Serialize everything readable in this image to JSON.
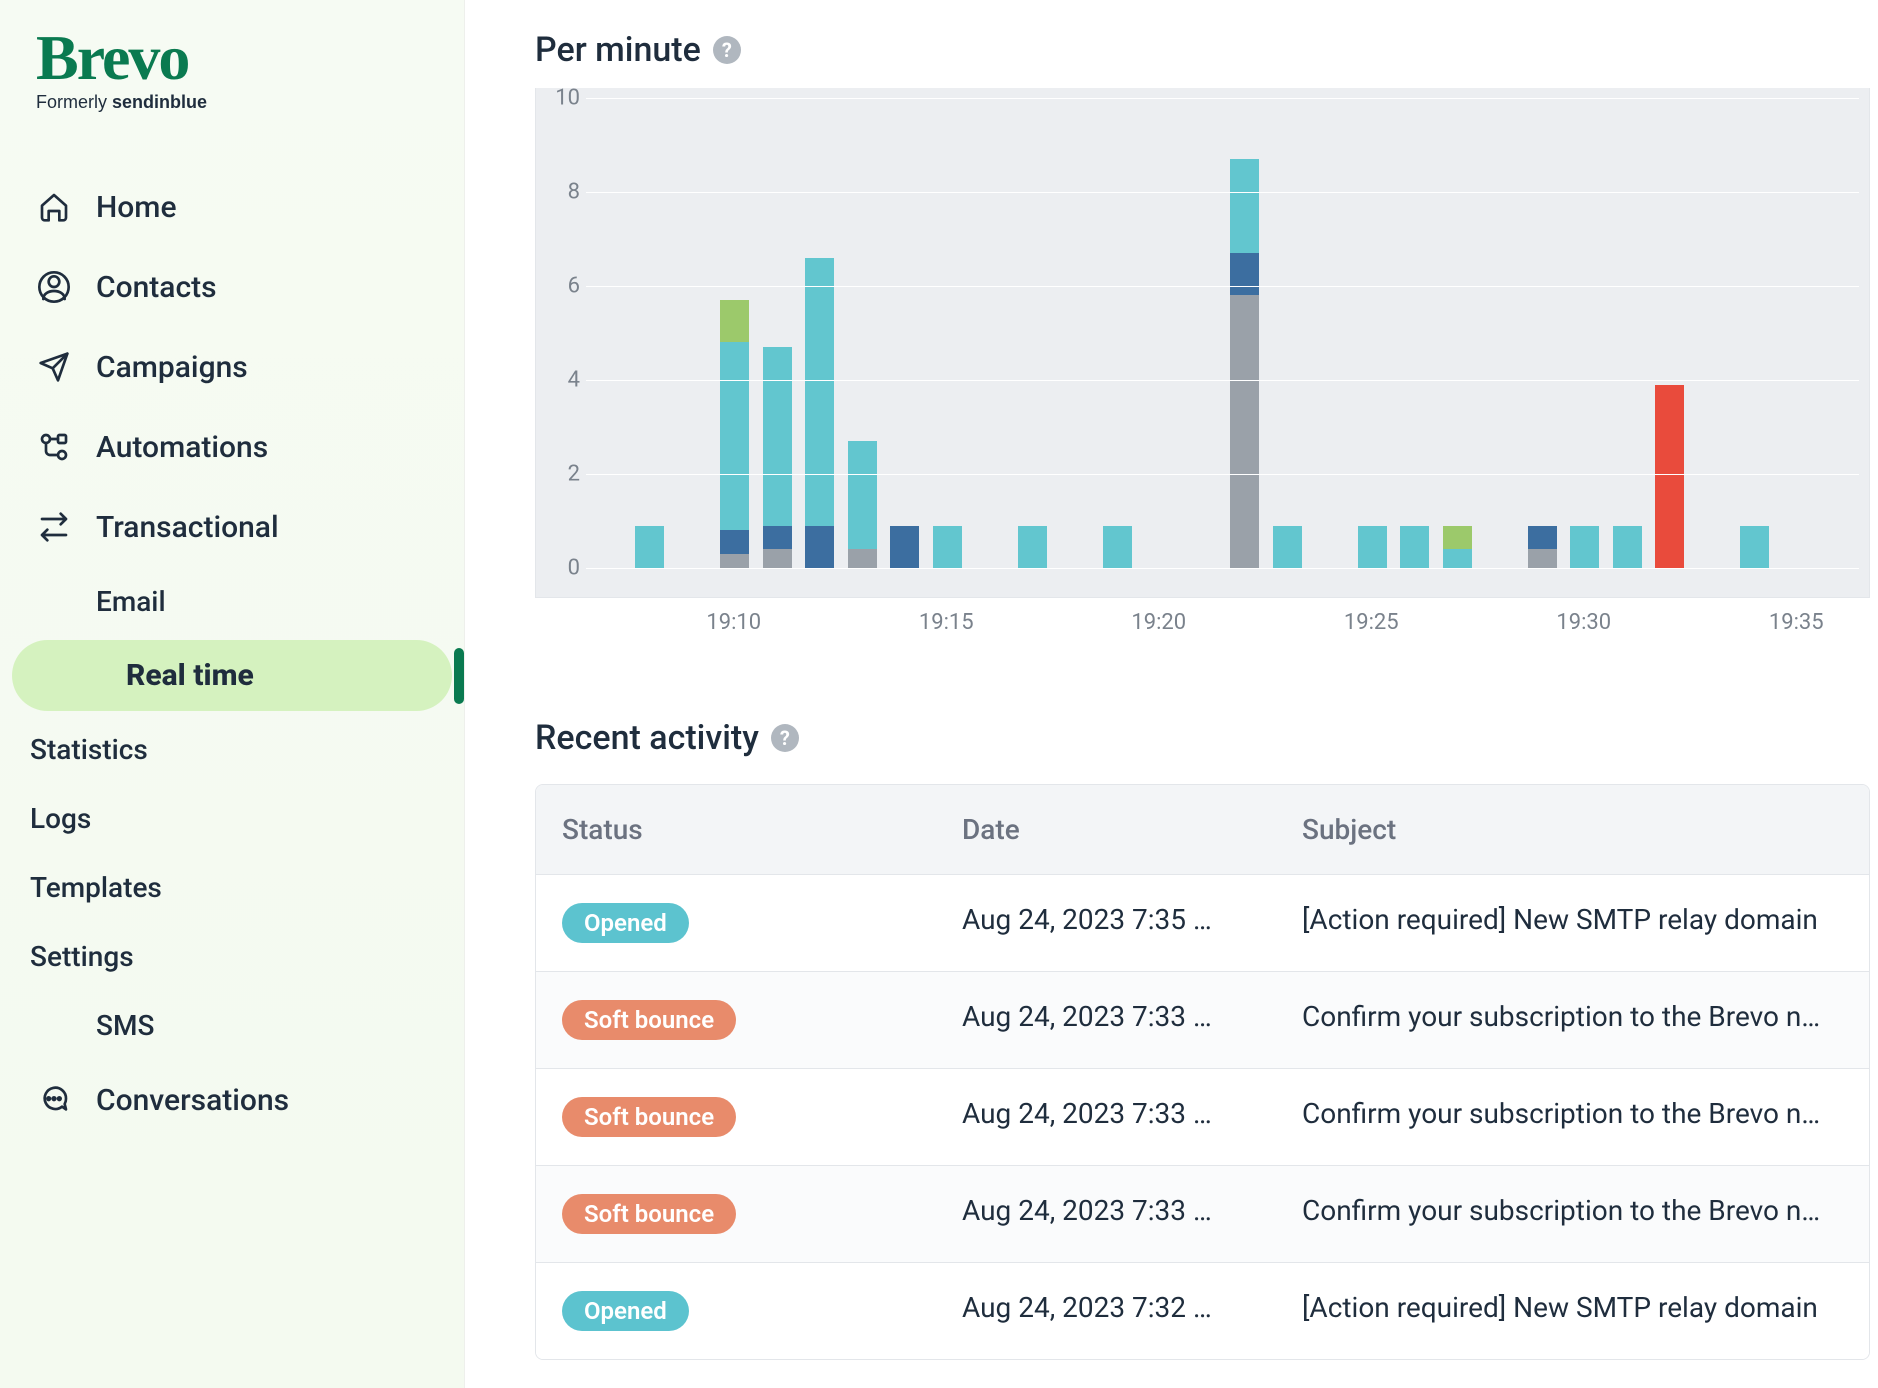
{
  "brand": {
    "name": "Brevo",
    "tagline_prefix": "Formerly ",
    "tagline_bold": "sendinblue"
  },
  "nav": {
    "home": "Home",
    "contacts": "Contacts",
    "campaigns": "Campaigns",
    "automations": "Automations",
    "transactional": "Transactional",
    "email": "Email",
    "real_time": "Real time",
    "statistics": "Statistics",
    "logs": "Logs",
    "templates": "Templates",
    "settings": "Settings",
    "sms": "SMS",
    "conversations": "Conversations"
  },
  "sections": {
    "per_minute": "Per minute",
    "recent_activity": "Recent activity"
  },
  "table": {
    "headers": {
      "status": "Status",
      "date": "Date",
      "subject": "Subject"
    },
    "rows": [
      {
        "status": "Opened",
        "status_class": "opened",
        "date": "Aug 24, 2023 7:35 …",
        "subject": "[Action required] New SMTP relay domain"
      },
      {
        "status": "Soft bounce",
        "status_class": "soft-bounce",
        "date": "Aug 24, 2023 7:33 …",
        "subject": "Confirm your subscription to the Brevo n…"
      },
      {
        "status": "Soft bounce",
        "status_class": "soft-bounce",
        "date": "Aug 24, 2023 7:33 …",
        "subject": "Confirm your subscription to the Brevo n…"
      },
      {
        "status": "Soft bounce",
        "status_class": "soft-bounce",
        "date": "Aug 24, 2023 7:33 …",
        "subject": "Confirm your subscription to the Brevo n…"
      },
      {
        "status": "Opened",
        "status_class": "opened",
        "date": "Aug 24, 2023 7:32 …",
        "subject": "[Action required] New SMTP relay domain"
      }
    ]
  },
  "chart_data": {
    "type": "bar",
    "title": "Per minute",
    "xlabel": "",
    "ylabel": "",
    "ylim": [
      0,
      10
    ],
    "y_ticks": [
      0,
      2,
      4,
      6,
      8,
      10
    ],
    "x_tick_labels": [
      "19:10",
      "19:15",
      "19:20",
      "19:25",
      "19:30",
      "19:35"
    ],
    "x_tick_positions": [
      3,
      8,
      13,
      18,
      23,
      28
    ],
    "colors": {
      "teal": "#62c6cf",
      "blue": "#3c6ea0",
      "gray": "#9aa1a9",
      "green": "#9cc96b",
      "red": "#e94b3c"
    },
    "series_legend": [
      "teal",
      "blue",
      "gray",
      "green",
      "red"
    ],
    "categories_count": 30,
    "stacks": {
      "1": [
        {
          "c": "teal",
          "v": 0.9
        }
      ],
      "3": [
        {
          "c": "gray",
          "v": 0.3
        },
        {
          "c": "blue",
          "v": 0.5
        },
        {
          "c": "teal",
          "v": 4.0
        },
        {
          "c": "green",
          "v": 0.9
        }
      ],
      "4": [
        {
          "c": "gray",
          "v": 0.4
        },
        {
          "c": "blue",
          "v": 0.5
        },
        {
          "c": "teal",
          "v": 3.8
        }
      ],
      "5": [
        {
          "c": "blue",
          "v": 0.9
        },
        {
          "c": "teal",
          "v": 5.7
        }
      ],
      "6": [
        {
          "c": "gray",
          "v": 0.4
        },
        {
          "c": "teal",
          "v": 2.3
        }
      ],
      "7": [
        {
          "c": "blue",
          "v": 0.9
        }
      ],
      "8": [
        {
          "c": "teal",
          "v": 0.9
        }
      ],
      "10": [
        {
          "c": "teal",
          "v": 0.9
        }
      ],
      "12": [
        {
          "c": "teal",
          "v": 0.9
        }
      ],
      "15": [
        {
          "c": "gray",
          "v": 5.8
        },
        {
          "c": "blue",
          "v": 0.9
        },
        {
          "c": "teal",
          "v": 2.0
        }
      ],
      "16": [
        {
          "c": "teal",
          "v": 0.9
        }
      ],
      "18": [
        {
          "c": "teal",
          "v": 0.9
        }
      ],
      "19": [
        {
          "c": "teal",
          "v": 0.9
        }
      ],
      "20": [
        {
          "c": "teal",
          "v": 0.4
        },
        {
          "c": "green",
          "v": 0.5
        }
      ],
      "22": [
        {
          "c": "gray",
          "v": 0.4
        },
        {
          "c": "blue",
          "v": 0.5
        }
      ],
      "23": [
        {
          "c": "teal",
          "v": 0.9
        }
      ],
      "24": [
        {
          "c": "teal",
          "v": 0.9
        }
      ],
      "25": [
        {
          "c": "red",
          "v": 3.9
        }
      ],
      "27": [
        {
          "c": "teal",
          "v": 0.9
        }
      ]
    }
  }
}
